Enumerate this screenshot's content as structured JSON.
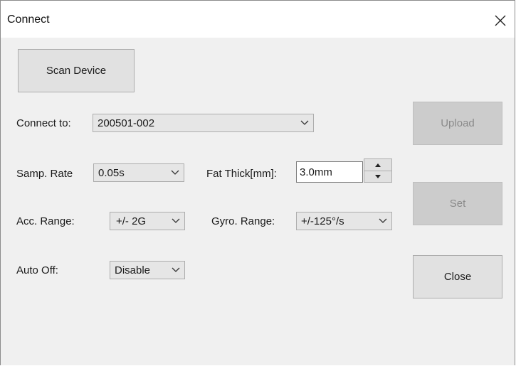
{
  "window": {
    "title": "Connect",
    "close_icon": "close-icon"
  },
  "buttons": {
    "scan": "Scan Device",
    "upload": "Upload",
    "set": "Set",
    "close": "Close"
  },
  "fields": {
    "connect_to": {
      "label": "Connect to:",
      "value": "200501-002"
    },
    "samp_rate": {
      "label": "Samp. Rate",
      "value": "0.05s"
    },
    "fat_thick": {
      "label": "Fat Thick[mm]:",
      "value": "3.0mm"
    },
    "acc_range": {
      "label": "Acc. Range:",
      "value": "+/- 2G"
    },
    "gyro_range": {
      "label": "Gyro. Range:",
      "value": "+/-125°/s"
    },
    "auto_off": {
      "label": "Auto Off:",
      "value": "Disable"
    }
  },
  "states": {
    "upload_enabled": false,
    "set_enabled": false
  }
}
